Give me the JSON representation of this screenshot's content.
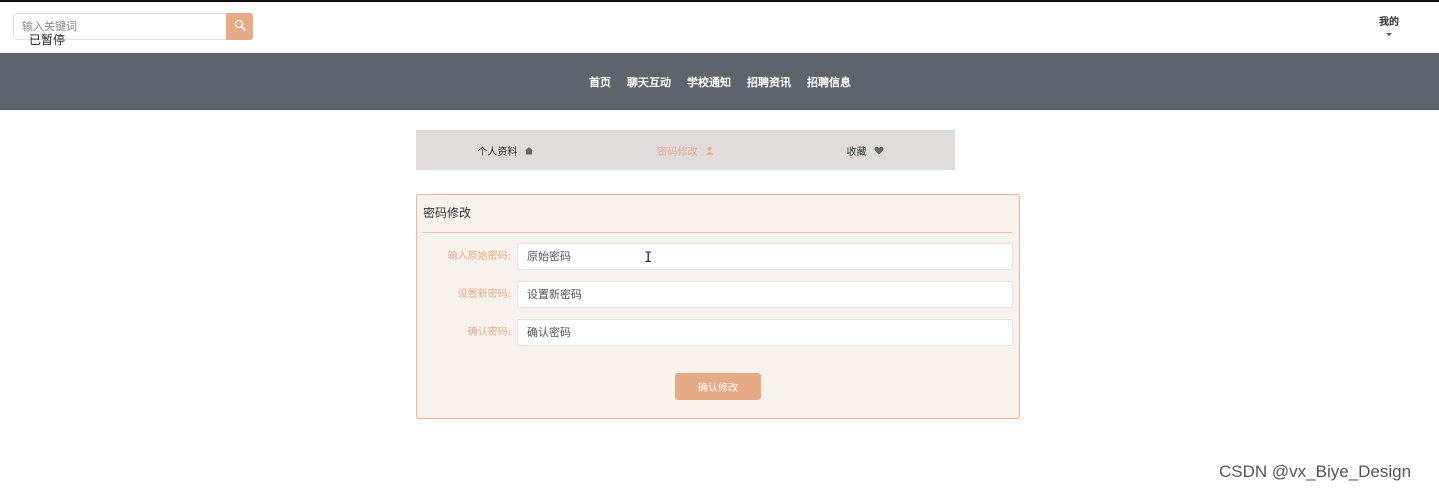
{
  "header": {
    "search": {
      "placeholder": "输入关键词",
      "value": ""
    },
    "overlay_text": "已暂停",
    "mine_label": "我的"
  },
  "nav": {
    "items": [
      "首页",
      "聊天互动",
      "学校通知",
      "招聘资讯",
      "招聘信息"
    ]
  },
  "tabs": [
    {
      "label": "个人资料",
      "icon": "home-icon",
      "active": false
    },
    {
      "label": "密码修改",
      "icon": "user-icon",
      "active": true
    },
    {
      "label": "收藏",
      "icon": "heart-icon",
      "active": false
    }
  ],
  "form": {
    "title": "密码修改",
    "fields": [
      {
        "label": "输入原始密码:",
        "placeholder": "原始密码"
      },
      {
        "label": "设置新密码:",
        "placeholder": "设置新密码"
      },
      {
        "label": "确认密码:",
        "placeholder": "确认密码"
      }
    ],
    "submit_label": "确认修改"
  },
  "watermark": "CSDN @vx_Biye_Design",
  "colors": {
    "accent": "#e8ab87",
    "nav_bg": "#5e646b",
    "tab_bg": "#e0dcdc",
    "panel_bg": "#f7f2ec",
    "panel_border": "#f2b49a"
  }
}
